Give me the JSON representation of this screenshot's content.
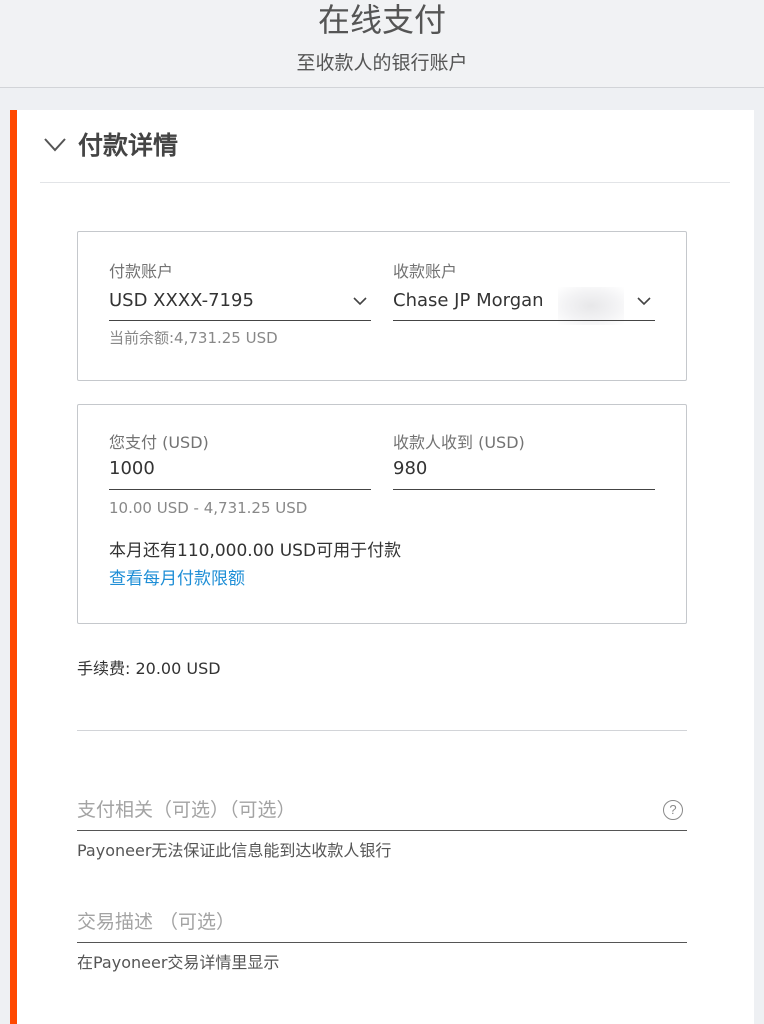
{
  "header": {
    "title": "在线支付",
    "subtitle": "至收款人的银行账户"
  },
  "section": {
    "title": "付款详情",
    "icon": "chevron-down-icon"
  },
  "accounts": {
    "payer_label": "付款账户",
    "payer_value": "USD XXXX-7195",
    "payer_balance": "当前余额:4,731.25 USD",
    "payee_label": "收款账户",
    "payee_value": "Chase JP Morgan"
  },
  "amounts": {
    "pay_label": "您支付 (USD)",
    "pay_value": "1000",
    "pay_range": "10.00 USD - 4,731.25 USD",
    "receive_label": "收款人收到 (USD)",
    "receive_value": "980",
    "monthly_limit_text": "本月还有110,000.00 USD可用于付款",
    "monthly_limit_link": "查看每月付款限额"
  },
  "fee": "手续费: 20.00 USD",
  "reference": {
    "placeholder": "支付相关（可选）（可选）",
    "help_icon": "?",
    "hint": "Payoneer无法保证此信息能到达收款人银行"
  },
  "description": {
    "placeholder": "交易描述 （可选）",
    "hint": "在Payoneer交易详情里显示"
  },
  "colors": {
    "accent": "#ff4800",
    "link": "#1e8ed6"
  }
}
